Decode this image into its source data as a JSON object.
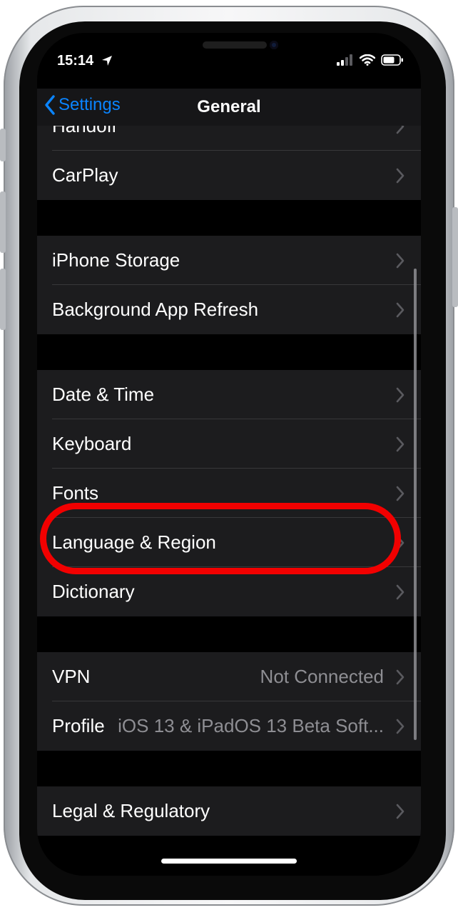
{
  "status_bar": {
    "time": "15:14",
    "icons": [
      "location-arrow-icon",
      "cellular-signal-icon",
      "wifi-icon",
      "battery-icon"
    ]
  },
  "nav": {
    "back_label": "Settings",
    "title": "General"
  },
  "groups": [
    {
      "rows": [
        {
          "label": "Handoff",
          "value": ""
        },
        {
          "label": "CarPlay",
          "value": ""
        }
      ]
    },
    {
      "rows": [
        {
          "label": "iPhone Storage",
          "value": ""
        },
        {
          "label": "Background App Refresh",
          "value": ""
        }
      ]
    },
    {
      "rows": [
        {
          "label": "Date & Time",
          "value": ""
        },
        {
          "label": "Keyboard",
          "value": ""
        },
        {
          "label": "Fonts",
          "value": ""
        },
        {
          "label": "Language & Region",
          "value": ""
        },
        {
          "label": "Dictionary",
          "value": ""
        }
      ]
    },
    {
      "rows": [
        {
          "label": "VPN",
          "value": "Not Connected"
        },
        {
          "label": "Profile",
          "value": "iOS 13 & iPadOS 13 Beta Soft..."
        }
      ]
    },
    {
      "rows": [
        {
          "label": "Legal & Regulatory",
          "value": ""
        }
      ]
    }
  ],
  "annotation": {
    "highlighted_row": "Keyboard",
    "color": "#f20000"
  },
  "colors": {
    "accent": "#0a84ff",
    "background": "#000000",
    "cell": "#1c1c1e",
    "secondary_text": "#8e8e93"
  }
}
